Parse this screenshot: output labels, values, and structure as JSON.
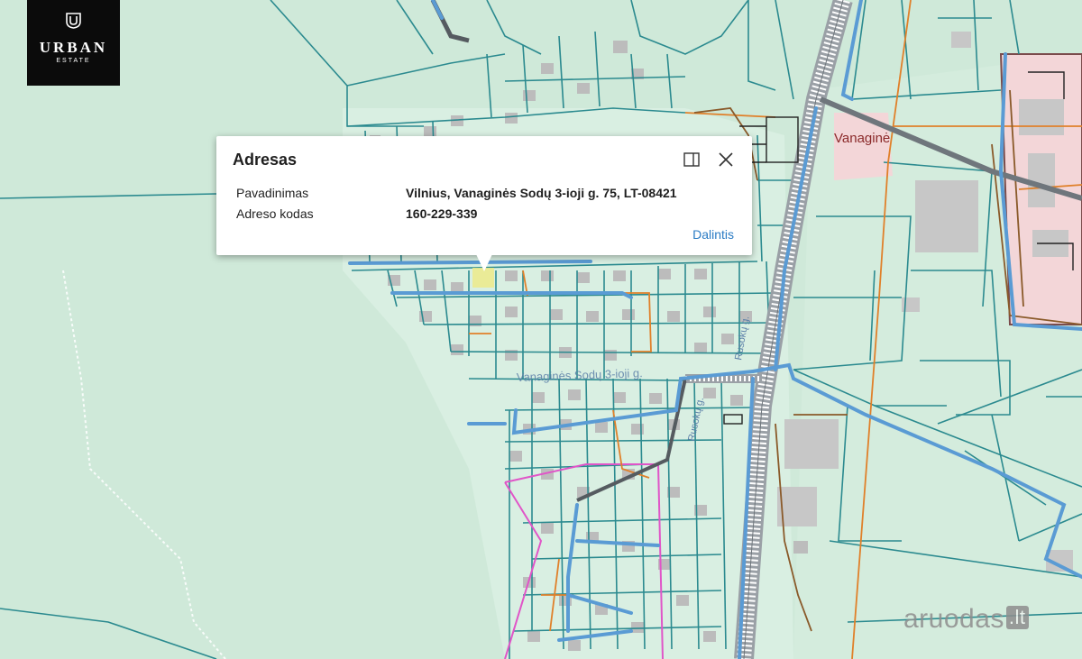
{
  "logo": {
    "line1": "URBAN",
    "line2": "ESTATE"
  },
  "popup": {
    "title": "Adresas",
    "rows": [
      {
        "label": "Pavadinimas",
        "value": "Vilnius, Vanaginės Sodų 3-ioji g. 75, LT-08421"
      },
      {
        "label": "Adreso kodas",
        "value": "160-229-339"
      }
    ],
    "share_label": "Dalintis"
  },
  "map": {
    "labels": {
      "district": "Vanaginė",
      "main_street": "Vanaginės Sodų 3-ioji g.",
      "side_street": "Rusokų g.",
      "lower_street": "Rusokų g."
    },
    "colors": {
      "background": "#cfe9d9",
      "parcel_line": "#2b8a8f",
      "street_blue": "#5a9bd4",
      "road_gray": "#9aa0a6",
      "utility_orange": "#e0802a",
      "boundary_pink": "#e055c8",
      "industrial_fill": "#f3d6d8",
      "building": "#c7c7c7"
    }
  },
  "watermark": {
    "text": "aruodas",
    "suffix": ".lt"
  }
}
